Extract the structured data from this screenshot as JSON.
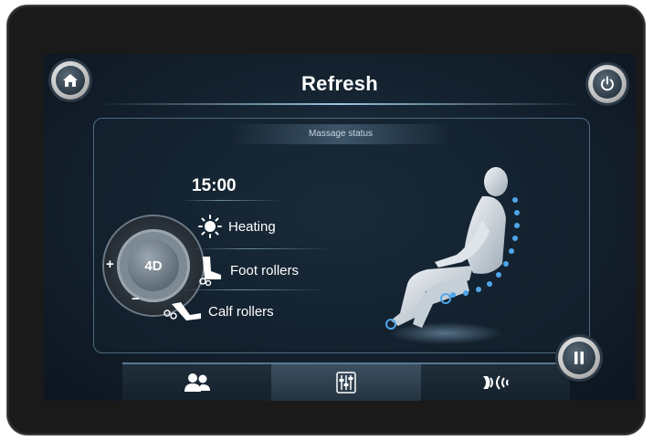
{
  "header": {
    "title": "Refresh"
  },
  "panel": {
    "status_title": "Massage status"
  },
  "timer": "15:00",
  "dial": {
    "label": "4D",
    "plus": "+",
    "minus": "−"
  },
  "modes": [
    {
      "label": "Heating",
      "icon": "sun-icon"
    },
    {
      "label": "Foot rollers",
      "icon": "foot-roller-icon"
    },
    {
      "label": "Calf rollers",
      "icon": "calf-roller-icon"
    }
  ],
  "buttons": {
    "home_icon": "home-icon",
    "power_icon": "power-icon",
    "pause_icon": "pause-icon"
  },
  "tabs": [
    {
      "icon": "users-icon"
    },
    {
      "icon": "adjust-sliders-icon"
    },
    {
      "icon": "vibration-icon"
    }
  ],
  "colors": {
    "accent": "#4fa6ea",
    "screen": "#13202d"
  }
}
